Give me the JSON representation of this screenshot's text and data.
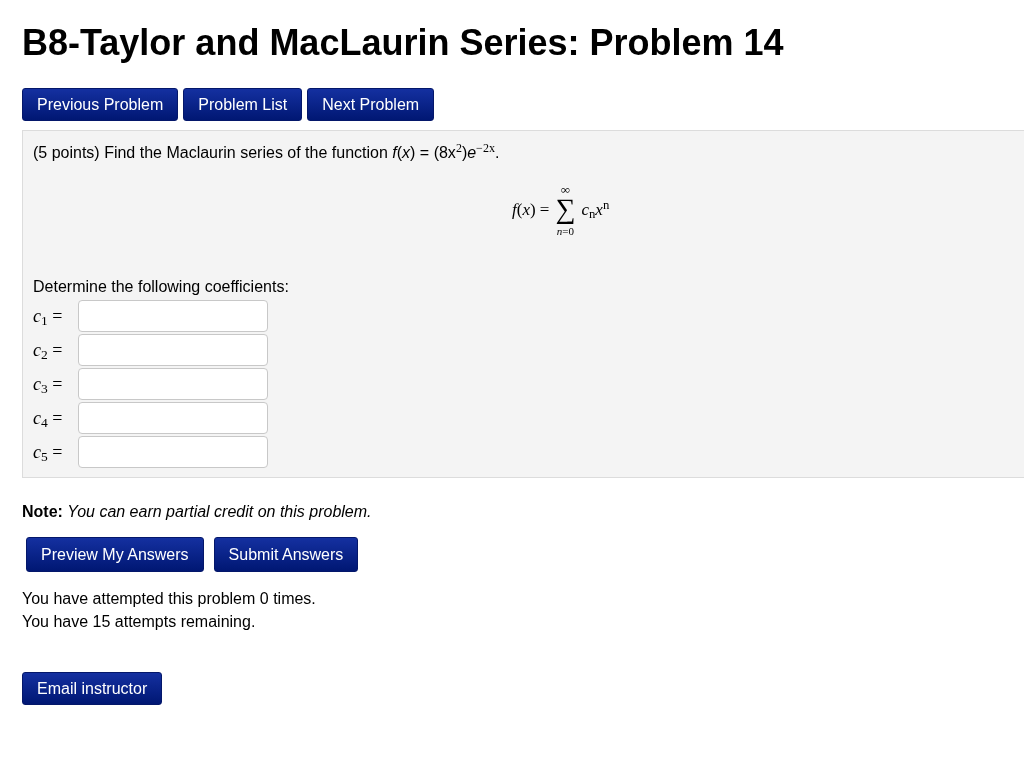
{
  "title": "B8-Taylor and MacLaurin Series: Problem 14",
  "nav_buttons": [
    "Previous Problem",
    "Problem List",
    "Next Problem"
  ],
  "problem": {
    "statement": "(5 points) Find the Maclaurin series of the function *f*(*x*) = (8x$^{2}$)*e*$^{−2x}$.",
    "series": {
      "lhs": "*f*(*x*) =",
      "sum_upper": "∞",
      "sum_symbol": "∑",
      "sum_lower": "*n*=0",
      "term": "*c*$_{n}$*x*$^{n}$"
    },
    "instruction": "Determine the following coefficients:",
    "coefficients": [
      {
        "label": "*c*$_{1}$ ="
      },
      {
        "label": "*c*$_{2}$ ="
      },
      {
        "label": "*c*$_{3}$ ="
      },
      {
        "label": "*c*$_{4}$ ="
      },
      {
        "label": "*c*$_{5}$ ="
      }
    ]
  },
  "note": "**Note:** *You can earn partial credit on this problem.*",
  "answer_buttons": [
    "Preview My Answers",
    "Submit Answers"
  ],
  "attempts": [
    "You have attempted this problem 0 times.",
    "You have 15 attempts remaining."
  ],
  "email_button": "Email instructor"
}
